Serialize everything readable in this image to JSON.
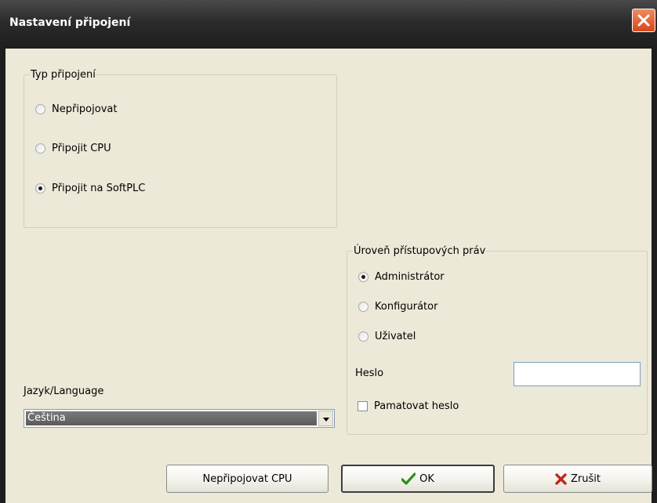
{
  "window": {
    "title": "Nastavení připojení"
  },
  "connection_type": {
    "legend": "Typ připojení",
    "options": [
      {
        "label": "Nepřipojovat",
        "selected": false
      },
      {
        "label": "Připojit CPU",
        "selected": false
      },
      {
        "label": "Připojit na SoftPLC",
        "selected": true
      }
    ]
  },
  "access_rights": {
    "legend": "Úroveň přístupových práv",
    "options": [
      {
        "label": "Administrátor",
        "selected": true
      },
      {
        "label": "Konfigurátor",
        "selected": false
      },
      {
        "label": "Uživatel",
        "selected": false
      }
    ],
    "password_label": "Heslo",
    "password_value": "",
    "remember_label": "Pamatovat heslo",
    "remember_checked": false
  },
  "language": {
    "label": "Jazyk/Language",
    "selected": "Čeština"
  },
  "buttons": {
    "no_connect": "Nepřipojovat CPU",
    "ok": "OK",
    "cancel": "Zrušit"
  },
  "icons": {
    "close": "close-icon",
    "ok": "checkmark-icon",
    "cancel": "cross-icon"
  },
  "colors": {
    "checkmark": "#2e8b1e",
    "cross": "#c0281e",
    "close_button": "#e0592a"
  }
}
